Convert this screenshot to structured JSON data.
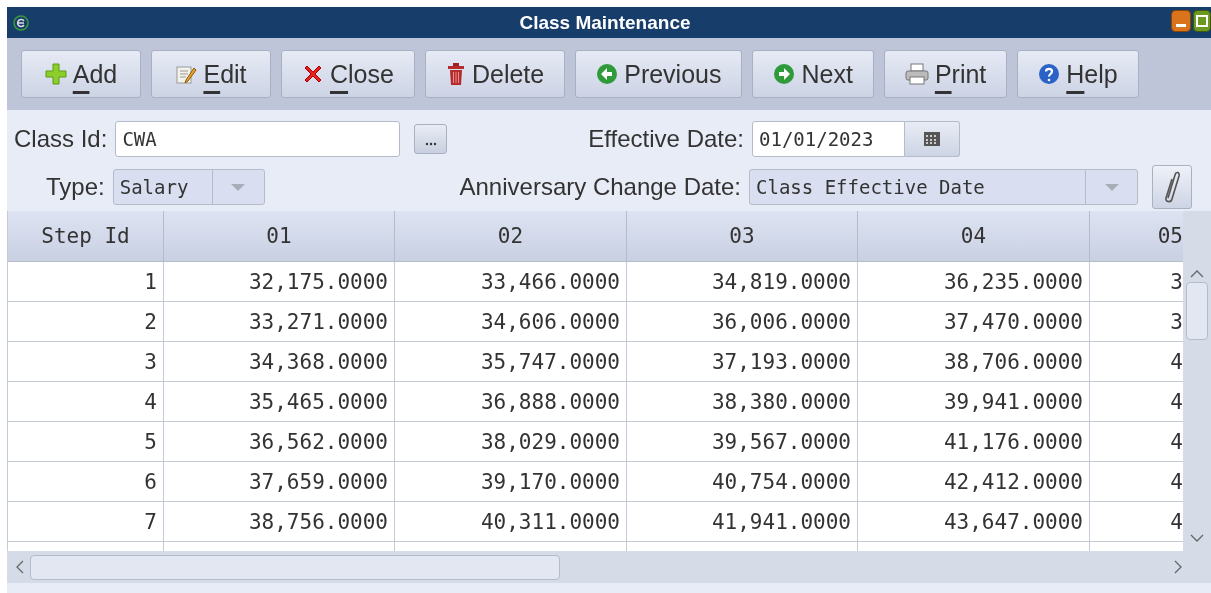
{
  "window": {
    "title": "Class Maintenance"
  },
  "toolbar": [
    {
      "label": "Add",
      "kind": "add",
      "mnemonic": true
    },
    {
      "label": "Edit",
      "kind": "edit",
      "mnemonic": true
    },
    {
      "label": "Close",
      "kind": "close",
      "mnemonic": true
    },
    {
      "label": "Delete",
      "kind": "delete",
      "mnemonic": false
    },
    {
      "label": "Previous",
      "kind": "previous",
      "mnemonic": false
    },
    {
      "label": "Next",
      "kind": "next",
      "mnemonic": false
    },
    {
      "label": "Print",
      "kind": "print",
      "mnemonic": true
    },
    {
      "label": "Help",
      "kind": "help",
      "mnemonic": true
    }
  ],
  "form": {
    "class_id": {
      "label": "Class Id:",
      "value": "CWA"
    },
    "effective_date": {
      "label": "Effective Date:",
      "value": "01/01/2023"
    },
    "type": {
      "label": "Type:",
      "value": "Salary"
    },
    "anniversary_change_date": {
      "label": "Anniversary Change Date:",
      "value": "Class Effective Date"
    }
  },
  "table": {
    "columns": [
      "Step Id",
      "01",
      "02",
      "03",
      "04",
      "05"
    ],
    "rows": [
      [
        "1",
        "32,175.0000",
        "33,466.0000",
        "34,819.0000",
        "36,235.0000",
        "3"
      ],
      [
        "2",
        "33,271.0000",
        "34,606.0000",
        "36,006.0000",
        "37,470.0000",
        "3"
      ],
      [
        "3",
        "34,368.0000",
        "35,747.0000",
        "37,193.0000",
        "38,706.0000",
        "4"
      ],
      [
        "4",
        "35,465.0000",
        "36,888.0000",
        "38,380.0000",
        "39,941.0000",
        "4"
      ],
      [
        "5",
        "36,562.0000",
        "38,029.0000",
        "39,567.0000",
        "41,176.0000",
        "4"
      ],
      [
        "6",
        "37,659.0000",
        "39,170.0000",
        "40,754.0000",
        "42,412.0000",
        "4"
      ],
      [
        "7",
        "38,756.0000",
        "40,311.0000",
        "41,941.0000",
        "43,647.0000",
        "4"
      ]
    ]
  }
}
